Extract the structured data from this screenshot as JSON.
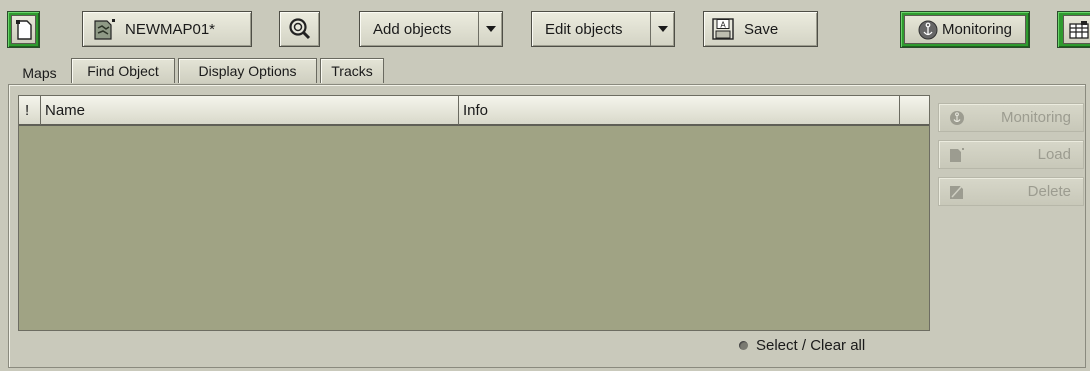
{
  "toolbar": {
    "map_name": "NEWMAP01*",
    "add_objects_label": "Add objects",
    "edit_objects_label": "Edit objects",
    "save_label": "Save",
    "monitoring_label": "Monitoring"
  },
  "tabs": [
    {
      "label": "Maps",
      "active": true
    },
    {
      "label": "Find Object",
      "active": false
    },
    {
      "label": "Display Options",
      "active": false
    },
    {
      "label": "Tracks",
      "active": false
    }
  ],
  "table": {
    "columns": [
      "!",
      "Name",
      "Info"
    ],
    "rows": []
  },
  "side_buttons": [
    {
      "label": "Monitoring",
      "icon": "anchor-icon",
      "enabled": false
    },
    {
      "label": "Load",
      "icon": "load-map-icon",
      "enabled": false
    },
    {
      "label": "Delete",
      "icon": "delete-map-icon",
      "enabled": false
    }
  ],
  "footer": {
    "select_clear_label": "Select / Clear all"
  },
  "colors": {
    "background": "#c9c9bb",
    "list_background": "#a0a384",
    "active_green": "#2f9a2f"
  }
}
